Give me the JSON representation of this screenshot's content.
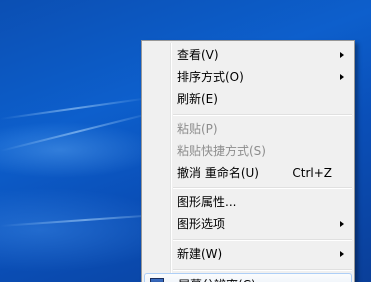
{
  "context_menu": {
    "items": [
      {
        "label": "查看(V)"
      },
      {
        "label": "排序方式(O)"
      },
      {
        "label": "刷新(E)"
      },
      {
        "label": "粘贴(P)"
      },
      {
        "label": "粘贴快捷方式(S)"
      },
      {
        "label": "撤消 重命名(U)",
        "shortcut": "Ctrl+Z"
      },
      {
        "label": "图形属性..."
      },
      {
        "label": "图形选项"
      },
      {
        "label": "新建(W)"
      },
      {
        "label": "屏幕分辨率(C)"
      }
    ]
  },
  "colors": {
    "desktop_blue": "#0d5fcc",
    "menu_background": "#f0f0f0",
    "disabled_text": "#8d8d8d"
  }
}
